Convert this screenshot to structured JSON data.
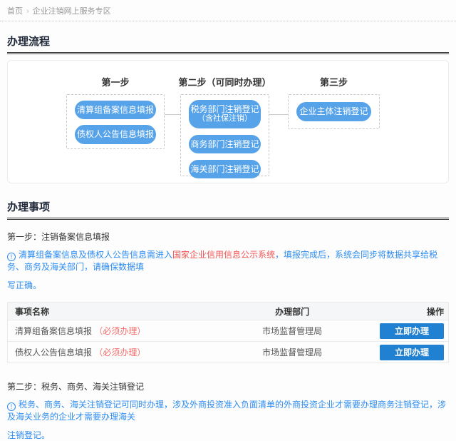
{
  "breadcrumb": {
    "home": "首页",
    "separator": "›",
    "current": "企业注销网上服务专区"
  },
  "icons": {
    "info": "!"
  },
  "flow_section": {
    "title": "办理流程",
    "steps": [
      {
        "label": "第一步",
        "buttons": [
          {
            "line1": "清算组备案信息填报"
          },
          {
            "line1": "债权人公告信息填报"
          }
        ]
      },
      {
        "label": "第二步（可同时办理）",
        "buttons": [
          {
            "line1": "税务部门注销登记",
            "line2": "（含社保注销）"
          },
          {
            "line1": "商务部门注销登记"
          },
          {
            "line1": "海关部门注销登记"
          }
        ]
      },
      {
        "label": "第三步",
        "buttons": [
          {
            "line1": "企业主体注销登记"
          }
        ]
      }
    ]
  },
  "items_section": {
    "title": "办理事项",
    "step1": {
      "heading": "第一步：注销备案信息填报",
      "note_prefix": "清算组备案信息及债权人公告信息需进入",
      "note_link": "国家企业信用信息公示系统",
      "note_suffix": "，填报完成后，系统会同步将数据共享给税务、商务及海关部门，请确保数据填",
      "note_tail": "写正确。",
      "table": {
        "headers": [
          "事项名称",
          "办理部门",
          "操作"
        ],
        "rows": [
          {
            "name": "清算组备案信息填报",
            "required": "（必须办理）",
            "department": "市场监督管理局",
            "action": "立即办理"
          },
          {
            "name": "债权人公告信息填报",
            "required": "（必须办理）",
            "department": "市场监督管理局",
            "action": "立即办理"
          }
        ]
      }
    },
    "step2": {
      "heading": "第二步：税务、商务、海关注销登记",
      "note": "税务、商务、海关注销登记可同时办理，涉及外商投资准入负面清单的外商投资企业才需要办理商务注销登记，涉及海关业务的企业才需要办理海关",
      "note_tail": "注销登记。"
    }
  },
  "colors": {
    "pill_blue": "#57a3e9",
    "action_button_blue": "#2080d2",
    "note_blue": "#2d8cf0",
    "link_red": "#f25353",
    "required_red": "#f56c6c",
    "title_dark": "#20293a"
  }
}
